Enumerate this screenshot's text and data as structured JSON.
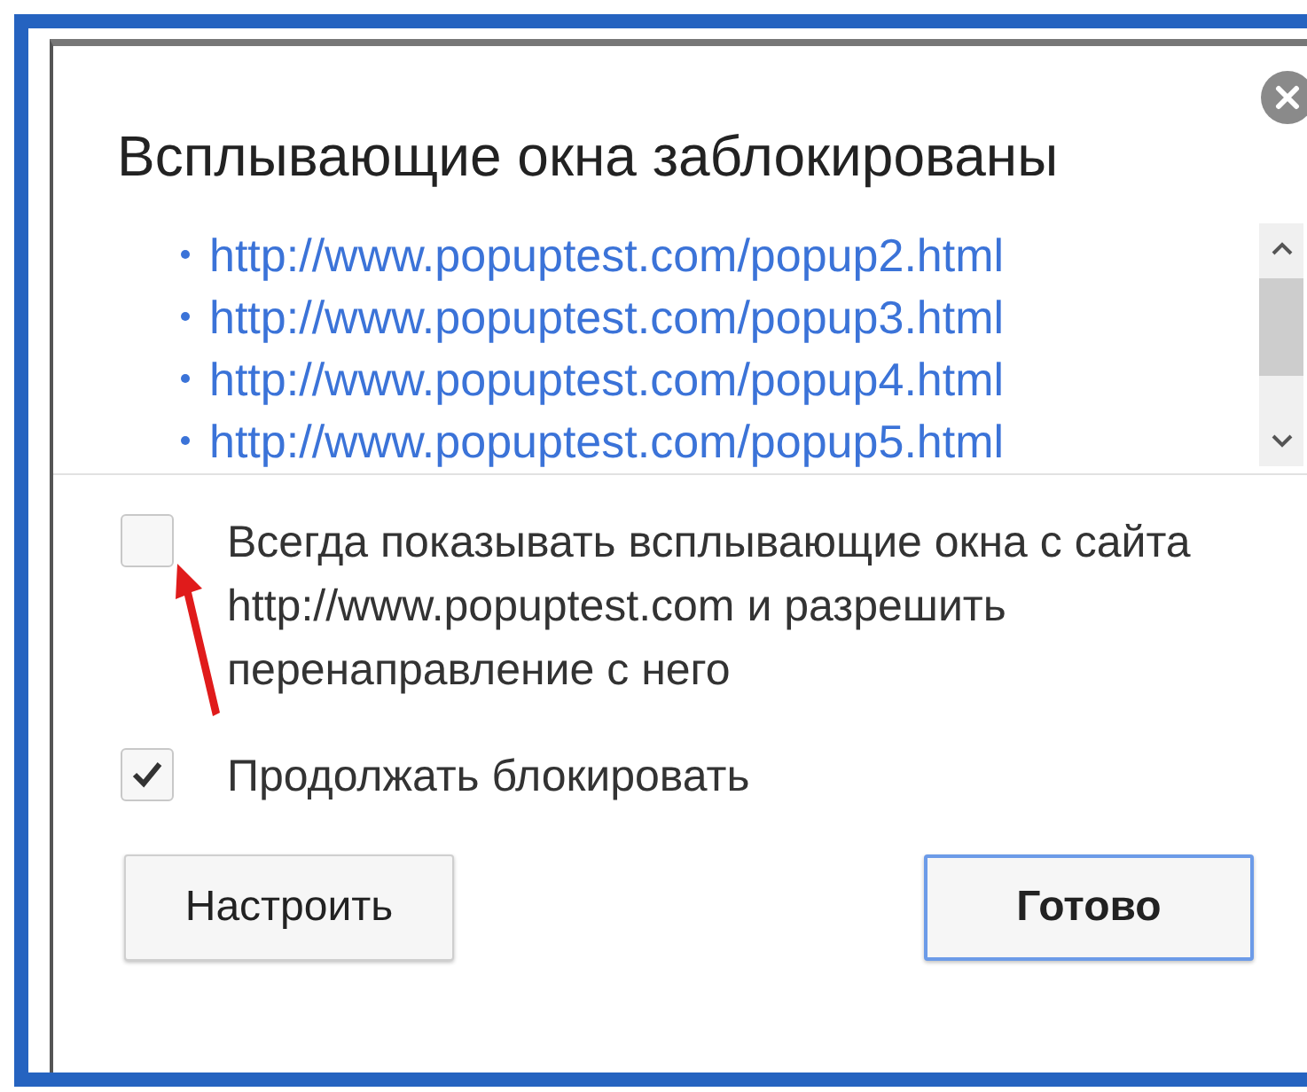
{
  "dialog": {
    "title": "Всплывающие окна заблокированы",
    "links": [
      "http://www.popuptest.com/popup2.html",
      "http://www.popuptest.com/popup3.html",
      "http://www.popuptest.com/popup4.html",
      "http://www.popuptest.com/popup5.html"
    ],
    "options": [
      {
        "label": "Всегда показывать всплывающие окна с сайта http://www.popuptest.com и разрешить перенаправление с него",
        "checked": false
      },
      {
        "label": "Продолжать блокировать",
        "checked": true
      }
    ],
    "buttons": [
      {
        "label": "Настроить",
        "default": false
      },
      {
        "label": "Готово",
        "default": true
      }
    ]
  }
}
